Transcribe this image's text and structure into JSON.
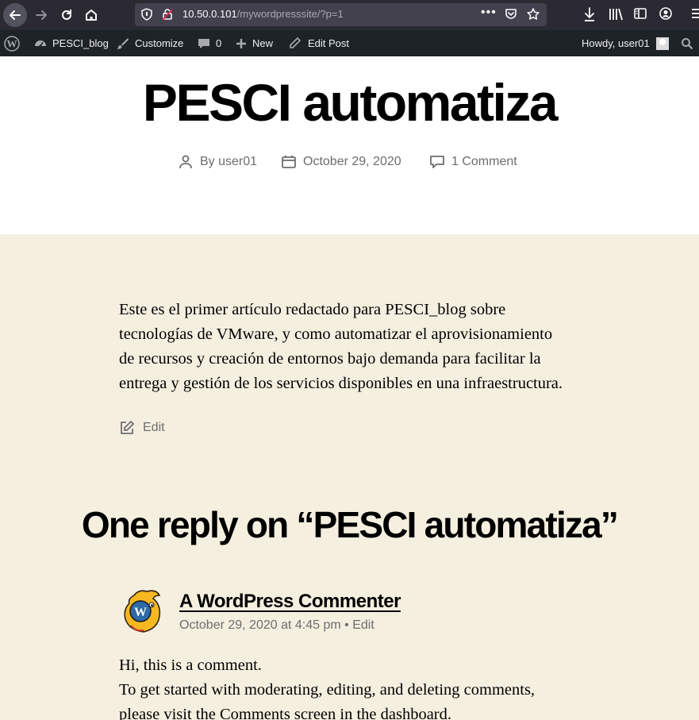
{
  "browser": {
    "url_host": "10.50.0.101",
    "url_path": "/mywordpresssite/?p=1",
    "page_actions": "•••"
  },
  "admin_bar": {
    "site_name": "PESCI_blog",
    "customize": "Customize",
    "comments_count": "0",
    "new": "New",
    "edit_post": "Edit Post",
    "howdy": "Howdy, user01"
  },
  "post": {
    "title": "PESCI automatiza",
    "author": "By user01",
    "date": "October 29, 2020",
    "comments": "1 Comment",
    "body_lines": [
      "Este es el primer artículo redactado para PESCI_blog sobre",
      "tecnologías de VMware, y como automatizar el aprovisionamiento",
      "de recursos y creación de entornos bajo demanda para facilitar la",
      "entrega y gestión de los servicios disponibles en una infraestructura."
    ],
    "edit": "Edit"
  },
  "comments": {
    "title": "One reply on “PESCI automatiza”",
    "items": [
      {
        "author": "A WordPress Commenter",
        "timestamp": "October 29, 2020 at 4:45 pm",
        "separator": " • ",
        "edit": "Edit",
        "body_lines": [
          "Hi, this is a comment.",
          "To get started with moderating, editing, and deleting comments,",
          "please visit the Comments screen in the dashboard."
        ]
      }
    ]
  },
  "colors": {
    "browser_bg": "#2b2a33",
    "admin_bar_bg": "#1d2327",
    "content_bg": "#f5efe0",
    "meta_text": "#6d6d6d"
  }
}
